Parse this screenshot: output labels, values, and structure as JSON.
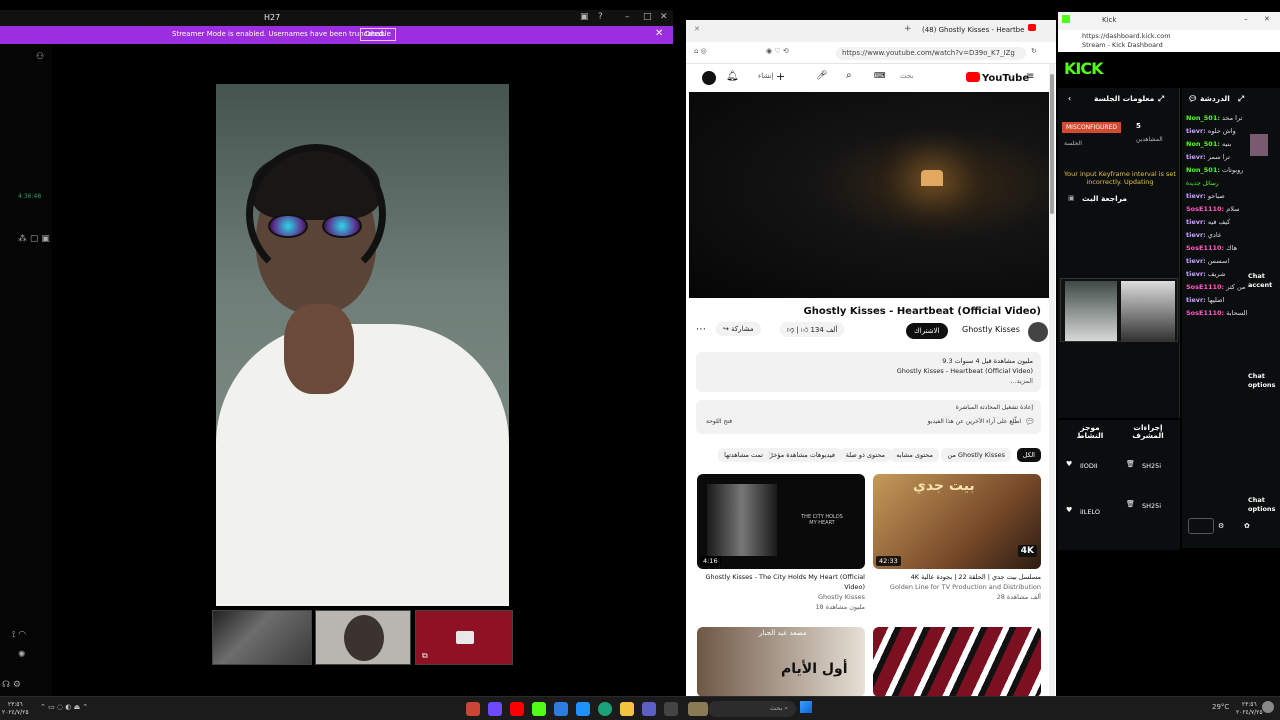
{
  "call_app": {
    "title": "H27",
    "streamer_banner": "Streamer Mode is enabled. Usernames have been truncated.",
    "disable_label": "Disable",
    "timer": "4:36:48"
  },
  "browser": {
    "tab_title": "(48) Ghostly Kisses - Heartbe",
    "url": "https://www.youtube.com/watch?v=D39o_K7_IZg",
    "search_placeholder": "بحث",
    "logo": "YouTube",
    "video": {
      "title": "Ghostly Kisses - Heartbeat (Official Video)",
      "channel": "Ghostly Kisses",
      "subscribe_label": "الاشتراك",
      "likes": "134 ألف",
      "share_label": "مشاركة",
      "description_line1": "9.3 مليون مشاهدة قبل 4 سنوات",
      "description_line2": "Ghostly Kisses - Heartbeat (Official Video)",
      "description_more": "...المزيد",
      "comments_title": "إعادة تشغيل المحادثة المباشرة",
      "comments_hint": "اطّلِع على آراء الآخرين عن هذا الفيديو",
      "chat_open": "فتح اللوحة"
    },
    "chips": [
      "الكل",
      "من Ghostly Kisses",
      "محتوى مشابه",
      "محتوى ذو صلة",
      "فيديوهات مشاهدة مؤخرًا",
      "تمت مشاهدتها"
    ],
    "recommendations": [
      {
        "title": "Ghostly Kisses - The City Holds My Heart (Official Video)",
        "channel": "Ghostly Kisses",
        "meta": "18 مليون مشاهدة",
        "duration": "4:16",
        "overlay": "THE CITY HOLDS MY HEART"
      },
      {
        "title": "4K مسلسل بيت جدي | الحلقة 22 | بجودة عالية",
        "channel": "Golden Line for TV Production and Distribution",
        "meta": "28 ألف مشاهدة",
        "duration": "42:33",
        "overlay": "بيت جدي",
        "badge": "4K"
      },
      {
        "title": "أول الأيام",
        "channel": "مصعد عبد الجبار",
        "meta": "",
        "duration": "",
        "overlay": "أول الأيام"
      },
      {
        "title": "",
        "channel": "",
        "meta": "",
        "duration": "",
        "overlay": ""
      }
    ]
  },
  "kick": {
    "tab_title": "Kick",
    "url_line1": "https://dashboard.kick.com",
    "url_line2": "Stream - Kick Dashboard",
    "logo": "KICK",
    "session_title": "معلومات الجلسة",
    "chat_title": "الدردشة",
    "status_badge": "MISCONFIGURED",
    "viewers_count": "5",
    "viewers_label": "المشاهدين",
    "session_label": "الجلسة",
    "keyframe_warning": "Your input Keyframe interval is set incorrectly. Updating",
    "review_title": "مراجعة البث",
    "mods_title": "إجراءات المشرف",
    "modes_title": "موجز النشاط",
    "chat_messages": [
      {
        "user": "Non_501:",
        "text": "ترا محد"
      },
      {
        "user": "tievr:",
        "text": "واش حلوه"
      },
      {
        "user": "Non_501:",
        "text": "بنيه"
      },
      {
        "user": "tievr:",
        "text": "ترا سمر"
      },
      {
        "user": "Non_501:",
        "text": "روبوتات"
      },
      {
        "user": "tievr:",
        "text": "صباحو"
      },
      {
        "user": "SosE1110:",
        "text": "سلام"
      },
      {
        "user": "tievr:",
        "text": "كيف فيه"
      },
      {
        "user": "tievr:",
        "text": "عادي"
      },
      {
        "user": "SosE1110:",
        "text": "هاك"
      },
      {
        "user": "tievr:",
        "text": "اسسس"
      },
      {
        "user": "tievr:",
        "text": "شريف"
      },
      {
        "user": "SosE1110:",
        "text": "من كثر"
      },
      {
        "user": "tievr:",
        "text": "اصليها"
      },
      {
        "user": "SosE1110:",
        "text": "السحابة"
      }
    ],
    "new_messages_label": "رسائل جديدة",
    "mod_rows": [
      {
        "name": "IlODII",
        "tag": "SH25i"
      },
      {
        "name": "iILELO",
        "tag": "SH25i"
      }
    ],
    "side_labels": [
      "Chat accent",
      "Chat options",
      "Chat options"
    ]
  },
  "taskbar": {
    "search_label": "بحث",
    "clock_time": "٢٣:٥٦",
    "clock_date": "٢٠٢٤/٧/٢٥",
    "weather": "29°C"
  },
  "colors": {
    "streamer_bar": "#9b2fe0",
    "kick_green": "#53fc18",
    "youtube_red": "#ff0000",
    "misconfigured": "#d34b2e"
  }
}
